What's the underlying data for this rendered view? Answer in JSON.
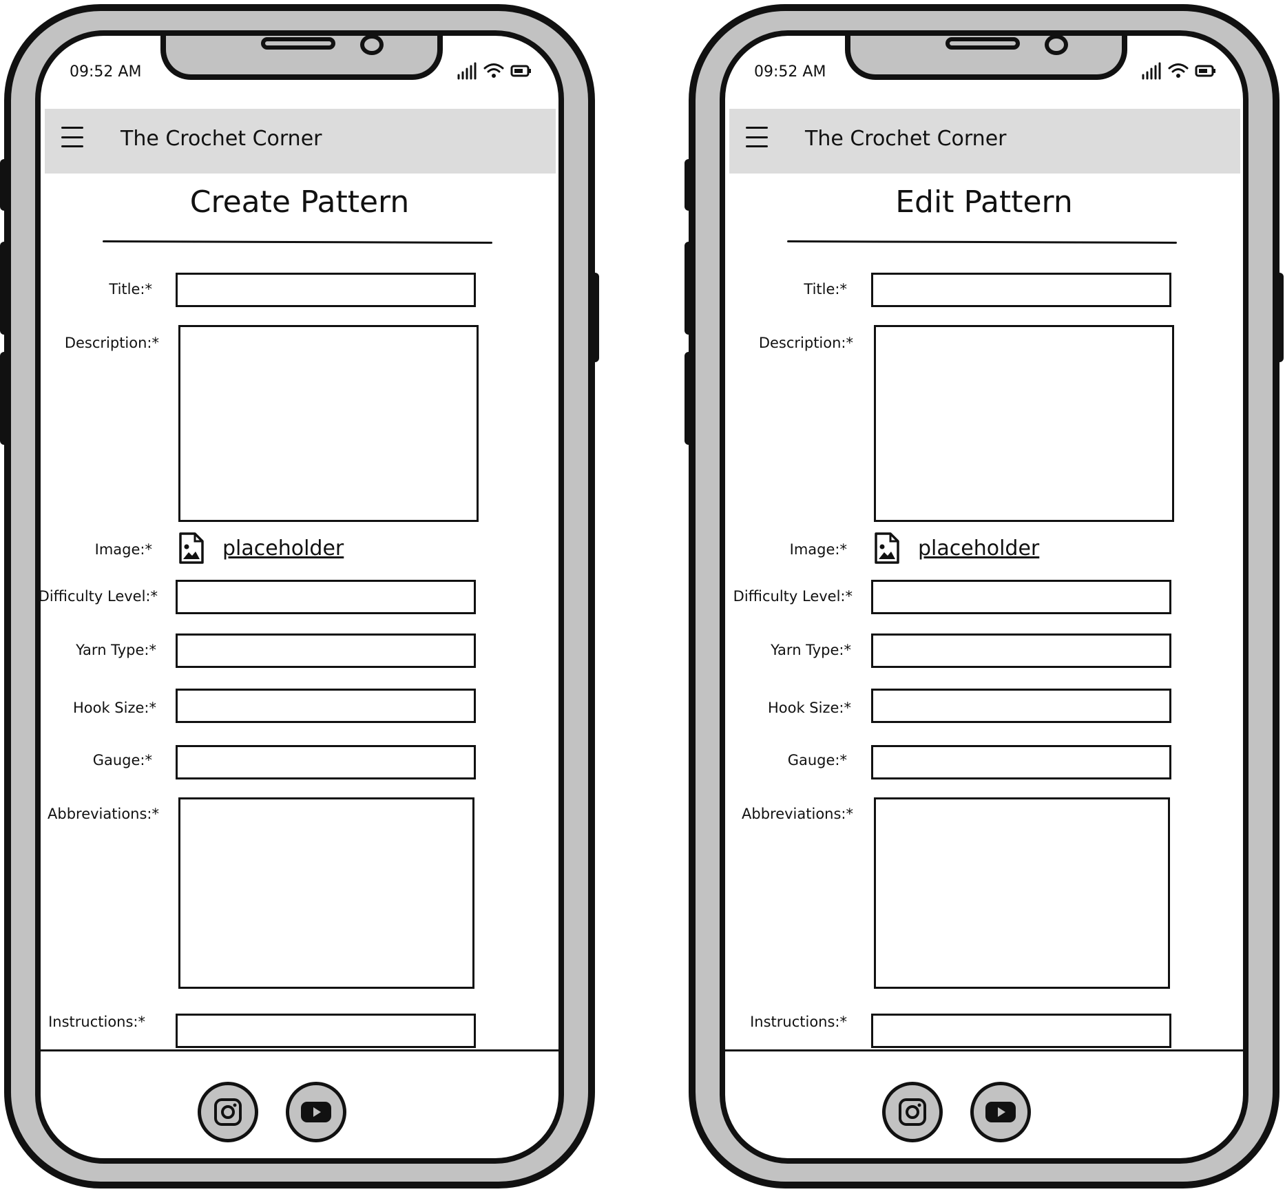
{
  "screens": [
    {
      "id": "left",
      "status": {
        "time": "09:52 AM"
      },
      "app_title": "The Crochet Corner",
      "page_title": "Create Pattern",
      "labels": {
        "title": "Title:*",
        "description": "Description:*",
        "image": "Image:*",
        "difficulty": "Difficulty Level:*",
        "yarn": "Yarn Type:*",
        "hook": "Hook Size:*",
        "gauge": "Gauge:*",
        "abbreviations": "Abbreviations:*",
        "instructions": "Instructions:*"
      },
      "image_link": "placeholder"
    },
    {
      "id": "right",
      "status": {
        "time": "09:52 AM"
      },
      "app_title": "The Crochet Corner",
      "page_title": "Edit Pattern",
      "labels": {
        "title": "Title:*",
        "description": "Description:*",
        "image": "Image:*",
        "difficulty": "Difficulty Level:*",
        "yarn": "Yarn Type:*",
        "hook": "Hook Size:*",
        "gauge": "Gauge:*",
        "abbreviations": "Abbreviations:*",
        "instructions": "Instructions:*"
      },
      "image_link": "placeholder"
    }
  ],
  "icons": {
    "menu": "hamburger-icon",
    "image_file": "image-file-icon",
    "social": [
      "instagram-icon",
      "youtube-icon"
    ],
    "status": [
      "signal-icon",
      "wifi-icon",
      "battery-icon"
    ]
  },
  "colors": {
    "frame": "#c2c2c2",
    "app_bar": "#dcdcdc",
    "ink": "#111111"
  }
}
